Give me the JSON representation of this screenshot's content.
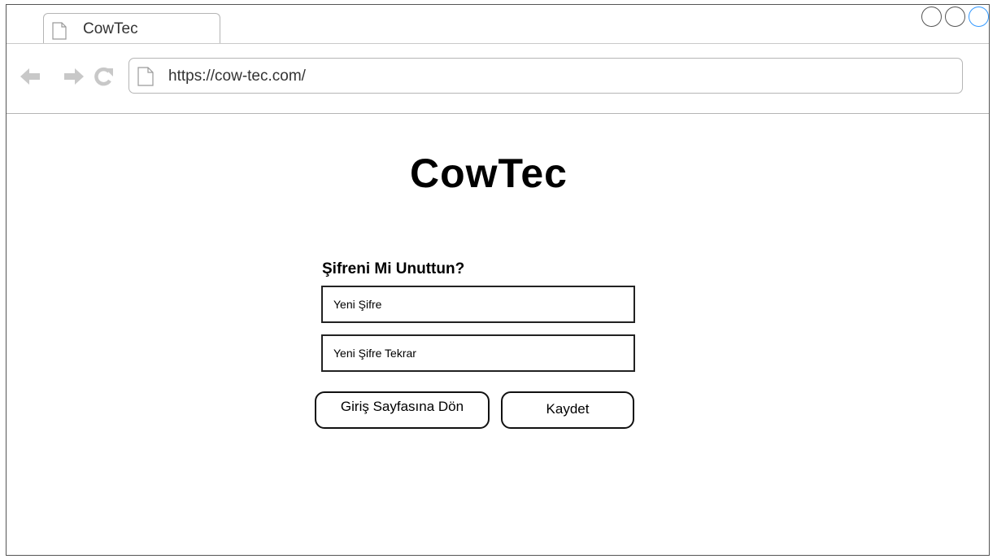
{
  "browser": {
    "tab_title": "CowTec",
    "url": "https://cow-tec.com/",
    "icons": {
      "tab": "document-icon",
      "back": "arrow-left-icon",
      "forward": "arrow-right-icon",
      "reload": "reload-icon",
      "url": "document-icon"
    },
    "window_controls": [
      "minimize",
      "maximize",
      "close"
    ]
  },
  "page": {
    "title": "CowTec",
    "form": {
      "heading": "Şifreni Mi Unuttun?",
      "new_password_placeholder": "Yeni Şifre",
      "confirm_password_placeholder": "Yeni Şifre Tekrar",
      "back_button_label": "Giriş Sayfasına Dön",
      "save_button_label": "Kaydet"
    }
  },
  "colors": {
    "active_control": "#3399ff",
    "nav_icons": "#c8c8c8",
    "border": "#222222"
  }
}
